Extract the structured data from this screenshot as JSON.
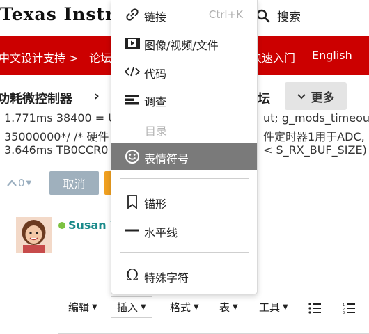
{
  "header": {
    "logo": "Texas Instru",
    "search_label": "搜索"
  },
  "nav": {
    "items": [
      "中文设计支持 >",
      "论坛",
      "快速入门",
      "English"
    ]
  },
  "breadcrumb": {
    "title": "功耗微控制器",
    "chevron": "›",
    "tail": "坛",
    "more_label": "更多"
  },
  "code": {
    "line1_left": "1.771ms 38400 = U",
    "line1_right": "ut; g_mods_timeout",
    "line2_left": "35000000*/ /* 硬件",
    "line2_right": "件定时器1用于ADC,",
    "line3_left": "3.646ms TB0CCR0",
    "line3_right": "< S_RX_BUF_SIZE) {"
  },
  "vote": {
    "count": "0"
  },
  "buttons": {
    "cancel": "取消"
  },
  "user": {
    "name": "Susan Y"
  },
  "toolbar": {
    "edit": "编辑",
    "insert": "插入",
    "format": "格式",
    "table": "表",
    "tools": "工具"
  },
  "menu": {
    "link": "链接",
    "link_shortcut": "Ctrl+K",
    "media": "图像/视频/文件",
    "code": "代码",
    "survey": "调查",
    "toc": "目录",
    "emoji": "表情符号",
    "anchor": "锚形",
    "hr": "水平线",
    "special_chars": "特殊字符"
  },
  "colors": {
    "brand_red": "#cc0000",
    "menu_active_bg": "#7a7a7a",
    "cancel_bg": "#9fb0bd",
    "online_dot": "#7dc242",
    "username": "#1a8a8a"
  }
}
